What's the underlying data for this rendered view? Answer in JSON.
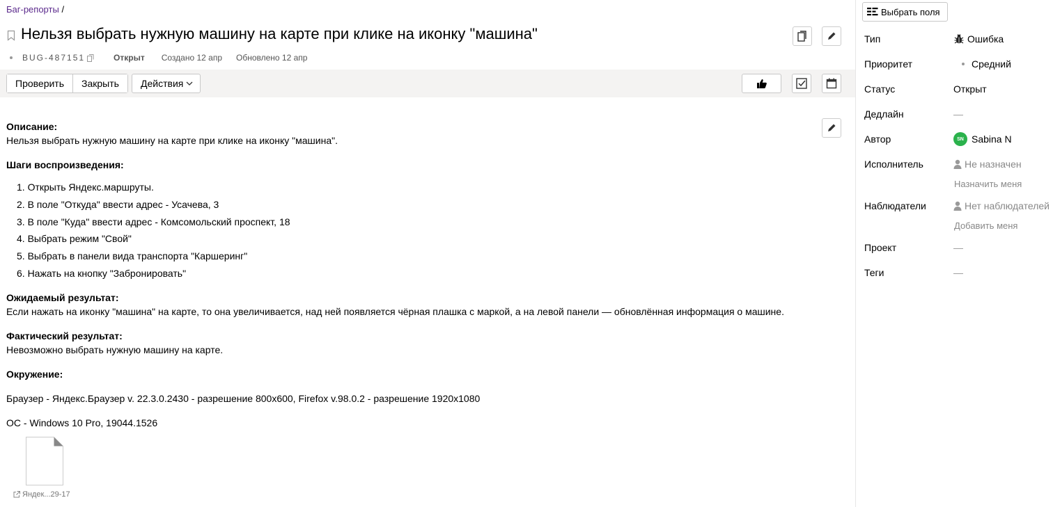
{
  "breadcrumb": {
    "link": "Баг-репорты",
    "separator": "/"
  },
  "issue": {
    "title": "Нельзя выбрать нужную машину на карте при клике на иконку \"машина\"",
    "key": "BUG-487151",
    "status": "Открыт",
    "created": "Создано 12 апр",
    "updated": "Обновлено 12 апр"
  },
  "toolbar": {
    "check_label": "Проверить",
    "close_label": "Закрыть",
    "actions_label": "Действия"
  },
  "description": {
    "desc_heading": "Описание:",
    "desc_text": "Нельзя выбрать нужную машину на карте при клике на иконку \"машина\".",
    "steps_heading": "Шаги воспроизведения:",
    "steps": [
      "1. Открыть Яндекс.маршруты.",
      "2. В поле \"Откуда\" ввести адрес - Усачева, 3",
      "3. В поле \"Куда\" ввести адрес - Комсомольский проспект, 18",
      "4. Выбрать режим \"Свой\"",
      "5. Выбрать в панели вида транспорта \"Каршеринг\"",
      "6. Нажать на кнопку \"Забронировать\""
    ],
    "expected_heading": "Ожидаемый результат:",
    "expected_text": "Если нажать на иконку \"машина\" на карте, то она увеличивается, над ней появляется чёрная плашка с маркой, а на левой панели — обновлённая информация о машине.",
    "actual_heading": "Фактический результат:",
    "actual_text": "Невозможно выбрать нужную машину на карте.",
    "env_heading": "Окружение:",
    "env_browser": "Браузер - Яндекс.Браузер v. 22.3.0.2430 - разрешение 800x600, Firefox v.98.0.2 - разрешение 1920x1080",
    "env_os": "ОС - Windows 10 Pro, 19044.1526"
  },
  "attachment": {
    "name": "Яндек...29-17"
  },
  "sidebar": {
    "pick_fields_label": "Выбрать поля",
    "type_label": "Тип",
    "type_value": "Ошибка",
    "priority_label": "Приоритет",
    "priority_value": "Средний",
    "status_label": "Статус",
    "status_value": "Открыт",
    "deadline_label": "Дедлайн",
    "deadline_value": "—",
    "author_label": "Автор",
    "author_initials": "SN",
    "author_value": "Sabina N",
    "assignee_label": "Исполнитель",
    "assignee_value": "Не назначен",
    "assign_me": "Назначить меня",
    "watchers_label": "Наблюдатели",
    "watchers_value": "Нет наблюдателей",
    "add_me": "Добавить меня",
    "project_label": "Проект",
    "project_value": "—",
    "tags_label": "Теги",
    "tags_value": "—"
  },
  "icons": {
    "bookmark": "bookmark-icon",
    "copy": "copy-icon",
    "edit": "pencil-icon",
    "like": "thumbs-up-icon",
    "checklist": "checkbox-icon",
    "calendar": "calendar-icon",
    "bug": "bug-icon",
    "user": "user-icon",
    "file": "file-icon",
    "external": "external-link-icon"
  }
}
